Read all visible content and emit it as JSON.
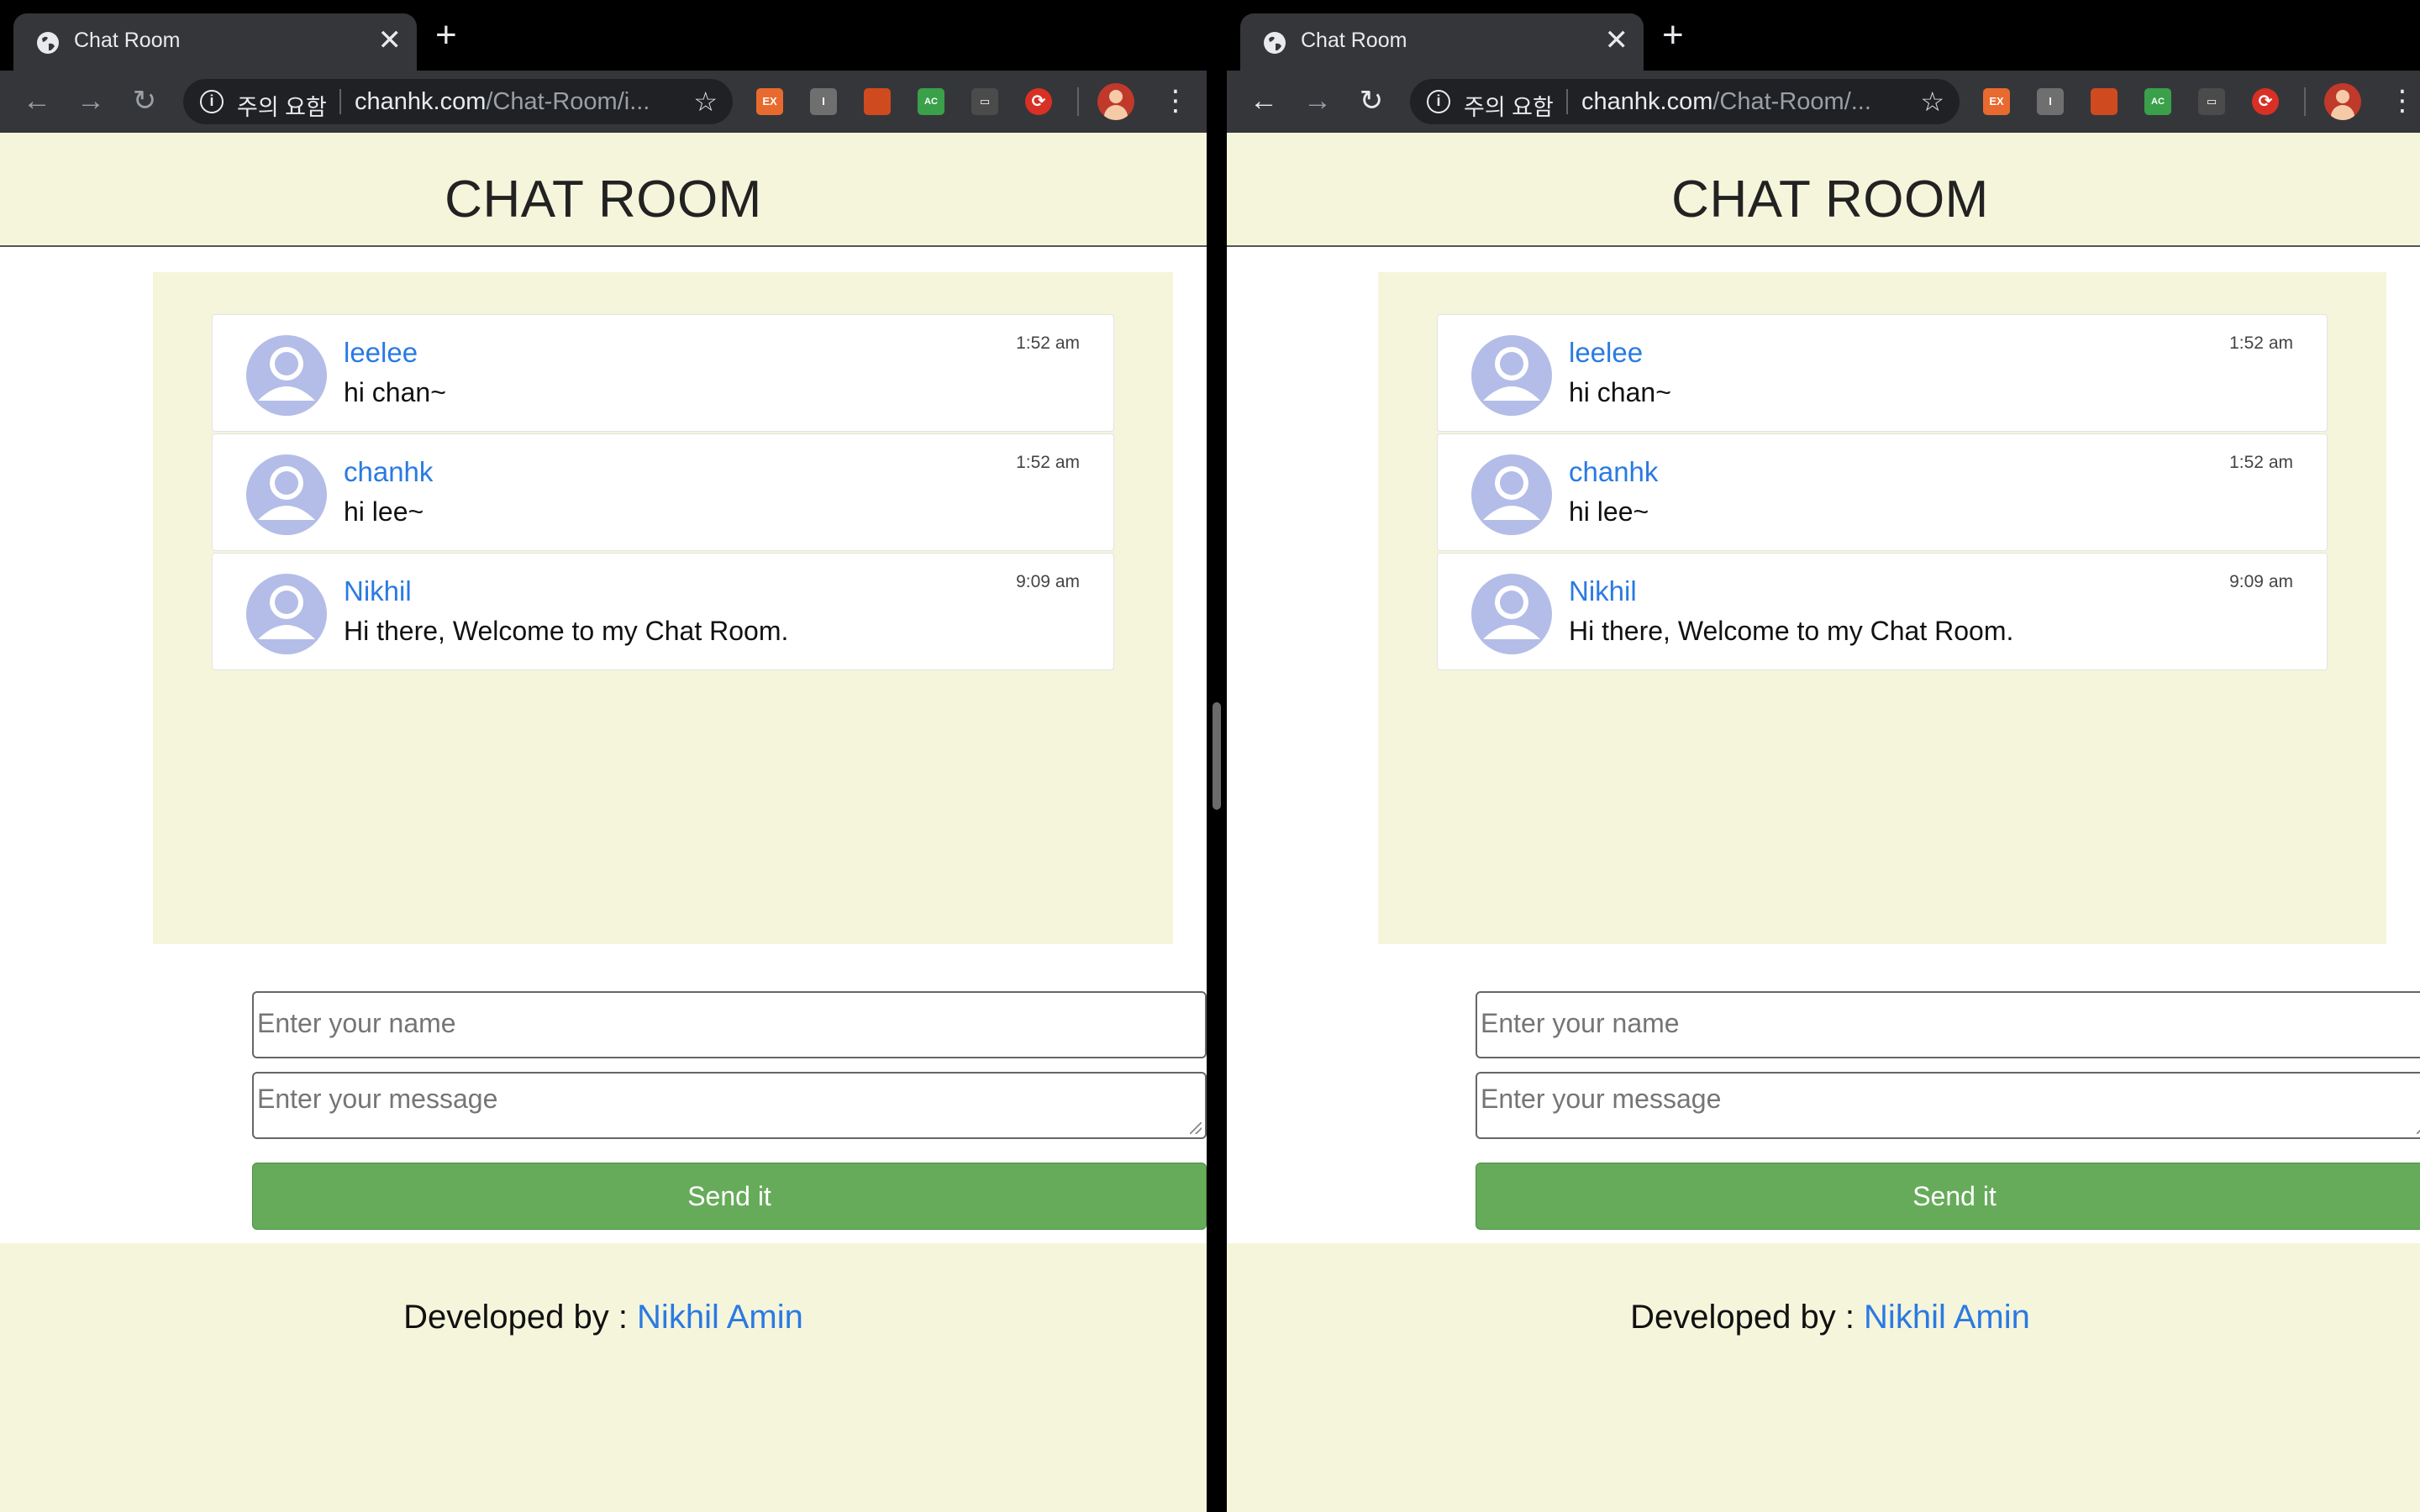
{
  "colors": {
    "page_bg": "#f5f5dc",
    "link": "#2a7ae2",
    "send_button": "#66ab5a",
    "avatar": "#b3bde8",
    "chrome_bg": "#35363a"
  },
  "icons": [
    "globe-icon",
    "close-icon",
    "plus-icon",
    "back-arrow-icon",
    "forward-arrow-icon",
    "reload-icon",
    "info-icon",
    "star-icon",
    "profile-avatar-icon",
    "more-vert-icon",
    "user-avatar-icon"
  ],
  "browser": {
    "tab_title": "Chat Room",
    "tab_close": "✕",
    "new_tab": "+",
    "security_label": "주의 요함",
    "url_host": "chanhk.com",
    "url_path_left": "/Chat-Room/i...",
    "url_path_right": "/Chat-Room/...",
    "extensions": [
      {
        "name": "ex-extension",
        "label": "EX",
        "color": "#e86a2f"
      },
      {
        "name": "i-extension",
        "label": "I",
        "color": "#6f6f6f"
      },
      {
        "name": "office-extension",
        "label": "",
        "color": "#d04a1f"
      },
      {
        "name": "ac-extension",
        "label": "AC",
        "color": "#3aa04a"
      },
      {
        "name": "screen-extension",
        "label": "▭",
        "color": "#4b4b4b"
      },
      {
        "name": "sync-extension",
        "label": "⟳",
        "color": "#d93025"
      }
    ]
  },
  "page": {
    "title": "CHAT ROOM",
    "messages": [
      {
        "user": "leelee",
        "text": "hi chan~",
        "time": "1:52 am"
      },
      {
        "user": "chanhk",
        "text": "hi lee~",
        "time": "1:52 am"
      },
      {
        "user": "Nikhil",
        "text": "Hi there, Welcome to my Chat Room.",
        "time": "9:09 am"
      }
    ],
    "name_placeholder": "Enter your name",
    "message_placeholder": "Enter your message",
    "send_label": "Send it",
    "footer_prefix": "Developed by : ",
    "footer_author": "Nikhil Amin"
  }
}
